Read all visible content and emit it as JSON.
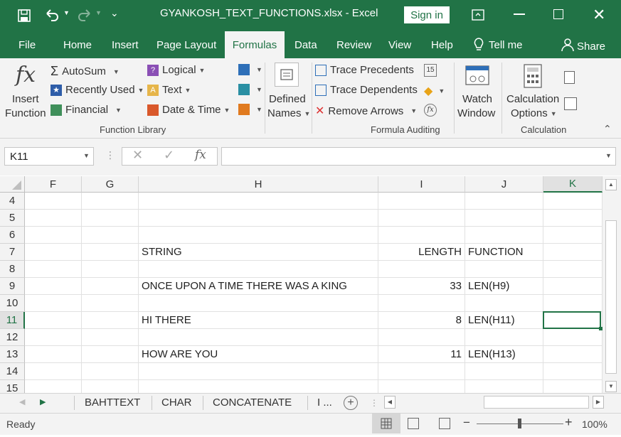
{
  "app": {
    "doc_title": "GYANKOSH_TEXT_FUNCTIONS.xlsx  -  Excel",
    "sign_in": "Sign in"
  },
  "tabs": [
    {
      "label": "File"
    },
    {
      "label": "Home"
    },
    {
      "label": "Insert"
    },
    {
      "label": "Page Layout"
    },
    {
      "label": "Formulas",
      "active": true
    },
    {
      "label": "Data"
    },
    {
      "label": "Review"
    },
    {
      "label": "View"
    },
    {
      "label": "Help"
    },
    {
      "label": "Tell me"
    },
    {
      "label": "Share"
    }
  ],
  "ribbon": {
    "insert_function": [
      "Insert",
      "Function"
    ],
    "autosum": "AutoSum",
    "recently_used": "Recently Used",
    "financial": "Financial",
    "logical": "Logical",
    "text": "Text",
    "date_time": "Date & Time",
    "defined_names": [
      "Defined",
      "Names"
    ],
    "trace_precedents": "Trace Precedents",
    "trace_dependents": "Trace Dependents",
    "remove_arrows": "Remove Arrows",
    "watch_window": [
      "Watch",
      "Window"
    ],
    "calculation_options": [
      "Calculation",
      "Options"
    ],
    "group_function_library": "Function Library",
    "group_formula_auditing": "Formula Auditing",
    "group_calculation": "Calculation"
  },
  "formula_bar": {
    "name_box": "K11",
    "fx": "fx",
    "value": ""
  },
  "grid": {
    "columns": [
      "F",
      "G",
      "H",
      "I",
      "J",
      "K"
    ],
    "selected_column": "K",
    "rows": [
      "4",
      "5",
      "6",
      "7",
      "8",
      "9",
      "10",
      "11",
      "12",
      "13",
      "14",
      "15"
    ],
    "selected_row": "11",
    "cells": {
      "H7": "STRING",
      "I7": "LENGTH",
      "J7": "FUNCTION",
      "H9": "ONCE UPON A TIME THERE WAS A KING",
      "I9": "33",
      "J9": "LEN(H9)",
      "H11": "HI THERE",
      "I11": "8",
      "J11": "LEN(H11)",
      "H13": "HOW ARE YOU",
      "I13": "11",
      "J13": "LEN(H13)"
    }
  },
  "sheets": [
    "BAHTTEXT",
    "CHAR",
    "CONCATENATE",
    "I ..."
  ],
  "status": {
    "ready": "Ready",
    "zoom": "100%"
  },
  "colors": {
    "excel_green": "#217346",
    "ribbon_bg": "#f3f3f3"
  }
}
